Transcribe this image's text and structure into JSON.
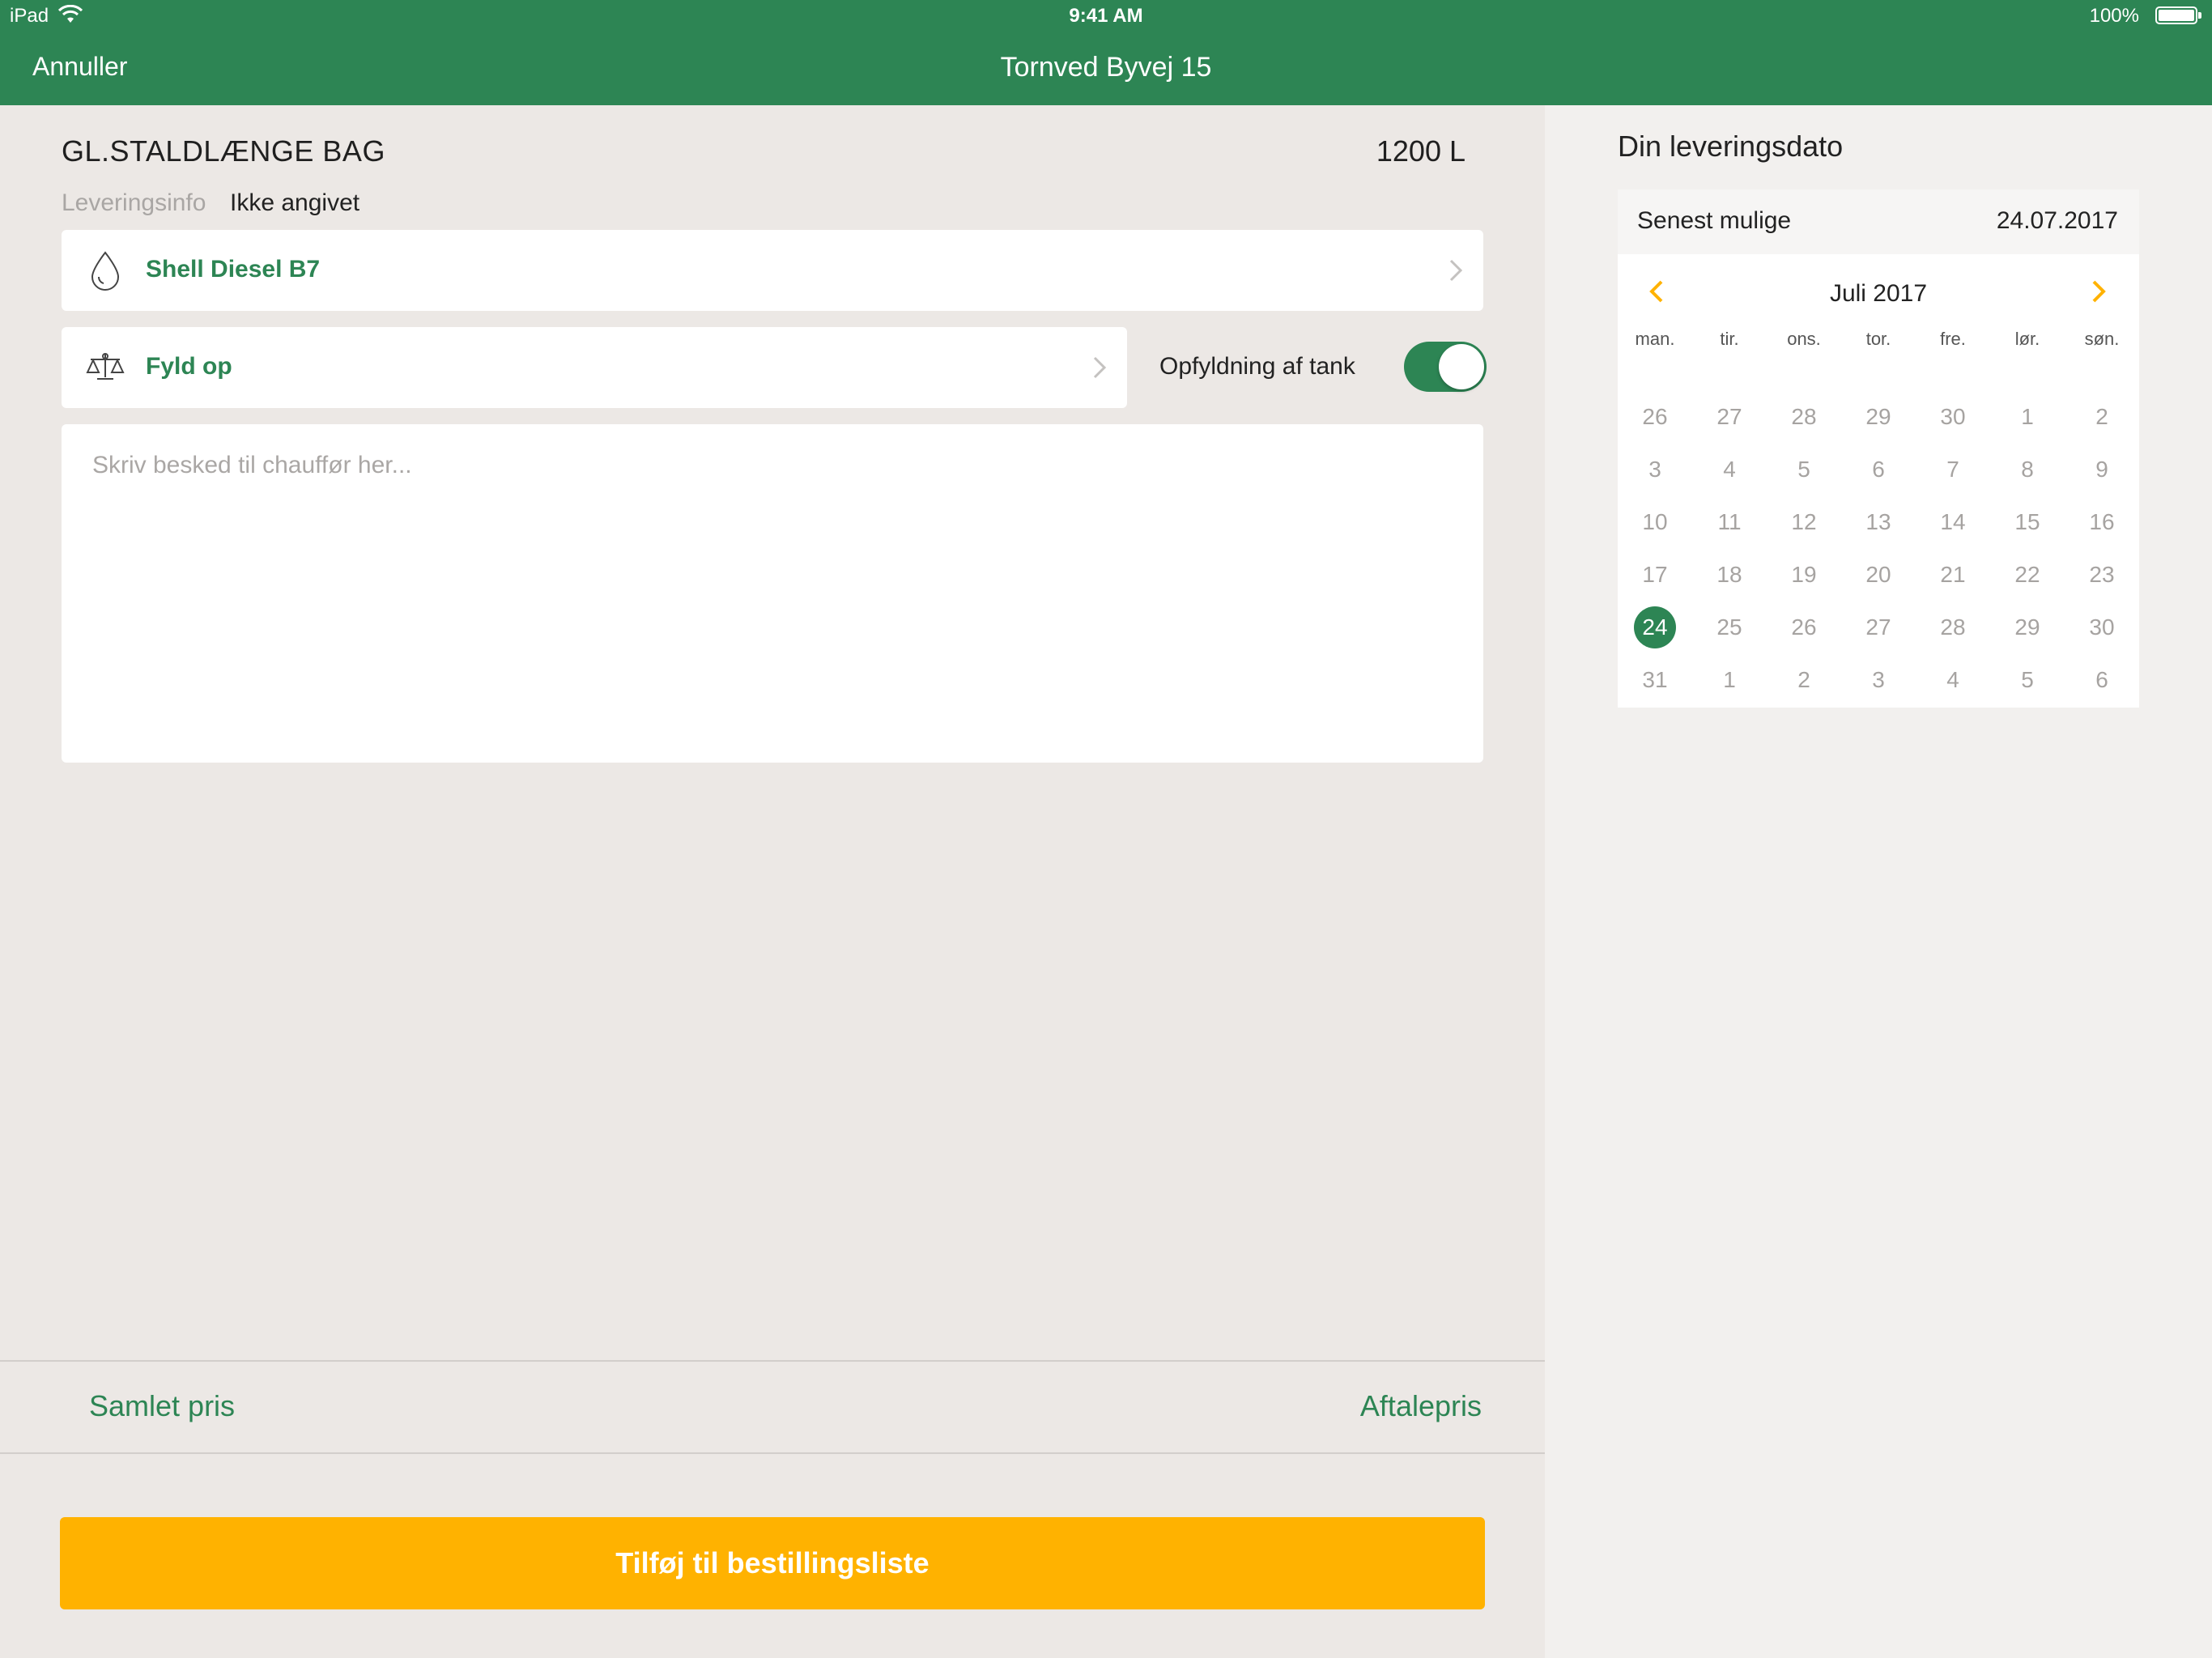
{
  "status_bar": {
    "carrier": "iPad",
    "time": "9:41 AM",
    "battery": "100%"
  },
  "nav": {
    "cancel_label": "Annuller",
    "title": "Tornved Byvej 15"
  },
  "order": {
    "tank_name": "GL.STALDLÆNGE BAG",
    "volume": "1200 L",
    "delivery_info_label": "Leveringsinfo",
    "delivery_info_value": "Ikke angivet",
    "product_label": "Shell Diesel B7",
    "product_icon": "droplet-icon",
    "quantity_label": "Fyld op",
    "quantity_icon": "scale-icon",
    "toggle_label": "Opfyldning af tank",
    "toggle_on": true,
    "message_placeholder": "Skriv besked til chauffør her...",
    "message_value": ""
  },
  "summary": {
    "total_label": "Samlet pris",
    "total_value": "Aftalepris"
  },
  "cta_label": "Tilføj til bestillingsliste",
  "delivery": {
    "title": "Din leveringsdato",
    "latest_label": "Senest mulige",
    "latest_value": "24.07.2017",
    "calendar": {
      "month_label": "Juli 2017",
      "weekdays": [
        "man.",
        "tir.",
        "ons.",
        "tor.",
        "fre.",
        "lør.",
        "søn."
      ],
      "days": [
        26,
        27,
        28,
        29,
        30,
        1,
        2,
        3,
        4,
        5,
        6,
        7,
        8,
        9,
        10,
        11,
        12,
        13,
        14,
        15,
        16,
        17,
        18,
        19,
        20,
        21,
        22,
        23,
        24,
        25,
        26,
        27,
        28,
        29,
        30,
        31,
        1,
        2,
        3,
        4,
        5,
        6
      ],
      "selected_index": 28
    }
  },
  "colors": {
    "brand": "#2d8554",
    "accent": "#ffb200",
    "background": "#ece8e5"
  }
}
